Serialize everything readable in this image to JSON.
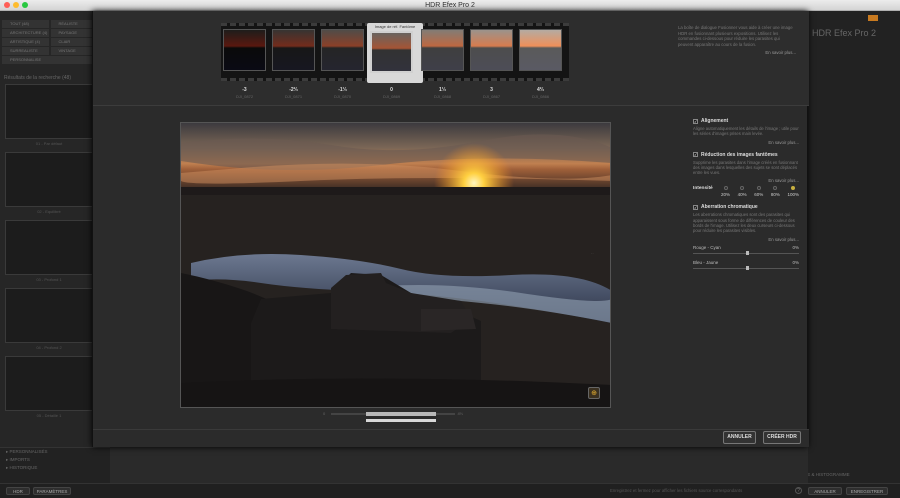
{
  "window": {
    "title": "HDR Efex Pro 2"
  },
  "background_app": {
    "left_tabs": [
      [
        "TOUT (48)",
        "RÉALISTE"
      ],
      [
        "ARCHITECTURE (4)",
        "PAYSAGE"
      ],
      [
        "ARTISTIQUE (4)",
        "CLAIR"
      ],
      [
        "SURREALISTE",
        "VINTAGE"
      ],
      [
        "PERSONNALISE",
        ""
      ]
    ],
    "left_label": "Résultats de la recherche (48)",
    "thumb_labels": [
      "01 - Par défaut",
      "02 - Equilibré",
      "03 - Profond 1",
      "04 - Profond 2",
      "05 - Détaillé 1"
    ],
    "bottom_rows": [
      "PERSONNALISÉS",
      "IMPORTS",
      "HISTORIQUE"
    ],
    "statusbar_left": [
      "HDR",
      "PARAMÈTRES"
    ],
    "statusbar_message": "Enregistrez et fermez pour afficher les fichiers source correspondants",
    "statusbar_buttons": [
      "ANNULER",
      "ENREGISTRER"
    ],
    "right_title": "HDR Efex Pro 2",
    "right_bottom": "LOUPE & HISTOGRAMME"
  },
  "dialog": {
    "ref_label": "Image de réf. Fantôme",
    "brackets": [
      {
        "ev": "-3",
        "file": "DJI_0872"
      },
      {
        "ev": "-2⅔",
        "file": "DJI_0871"
      },
      {
        "ev": "-1⅓",
        "file": "DJI_0870"
      },
      {
        "ev": "0",
        "file": "DJI_0869"
      },
      {
        "ev": "1⅓",
        "file": "DJI_0868"
      },
      {
        "ev": "3",
        "file": "DJI_0867"
      },
      {
        "ev": "4⅔",
        "file": "DJI_0866"
      }
    ],
    "selected_index": 3,
    "info_top": "La boîte de dialogue Fusionner vous aide à créer une image HDR en fusionnant plusieurs expositions. Utilisez les commandes ci-dessous pour réduire les parasites qui peuvent apparaître au cours de la fusion.",
    "learn_more": "En savoir plus...",
    "alignment": {
      "title": "Alignement",
      "text": "Aligne automatiquement les détails de l'image ; utile pour les séries d'images prises main levée.",
      "link": "En savoir plus..."
    },
    "ghost": {
      "title": "Réduction des images fantômes",
      "text": "Supprime les parasites dans l'image créés en fusionnant des images dans lesquelles des sujets se sont déplacés entre les vues.",
      "link": "En savoir plus...",
      "intensity_label": "Intensité",
      "levels": [
        "20%",
        "40%",
        "60%",
        "80%",
        "100%"
      ],
      "selected_level": 4
    },
    "chromatic": {
      "title": "Aberration chromatique",
      "text": "Les aberrations chromatiques sont des parasites qui apparaissent sous forme de différences de couleur des bords de l'image. Utilisez les deux curseurs ci-dessous pour réduire les parasites visibles.",
      "link": "En savoir plus...",
      "red_cyan_label": "Rouge - Cyan",
      "red_cyan_value": "0%",
      "blue_yellow_label": "Bleu - Jaune",
      "blue_yellow_value": "0%"
    },
    "preview_slider": {
      "min_label": "0",
      "max_label": "4⅔"
    },
    "cancel_label": "ANNULER",
    "create_label": "CRÉER HDR"
  }
}
